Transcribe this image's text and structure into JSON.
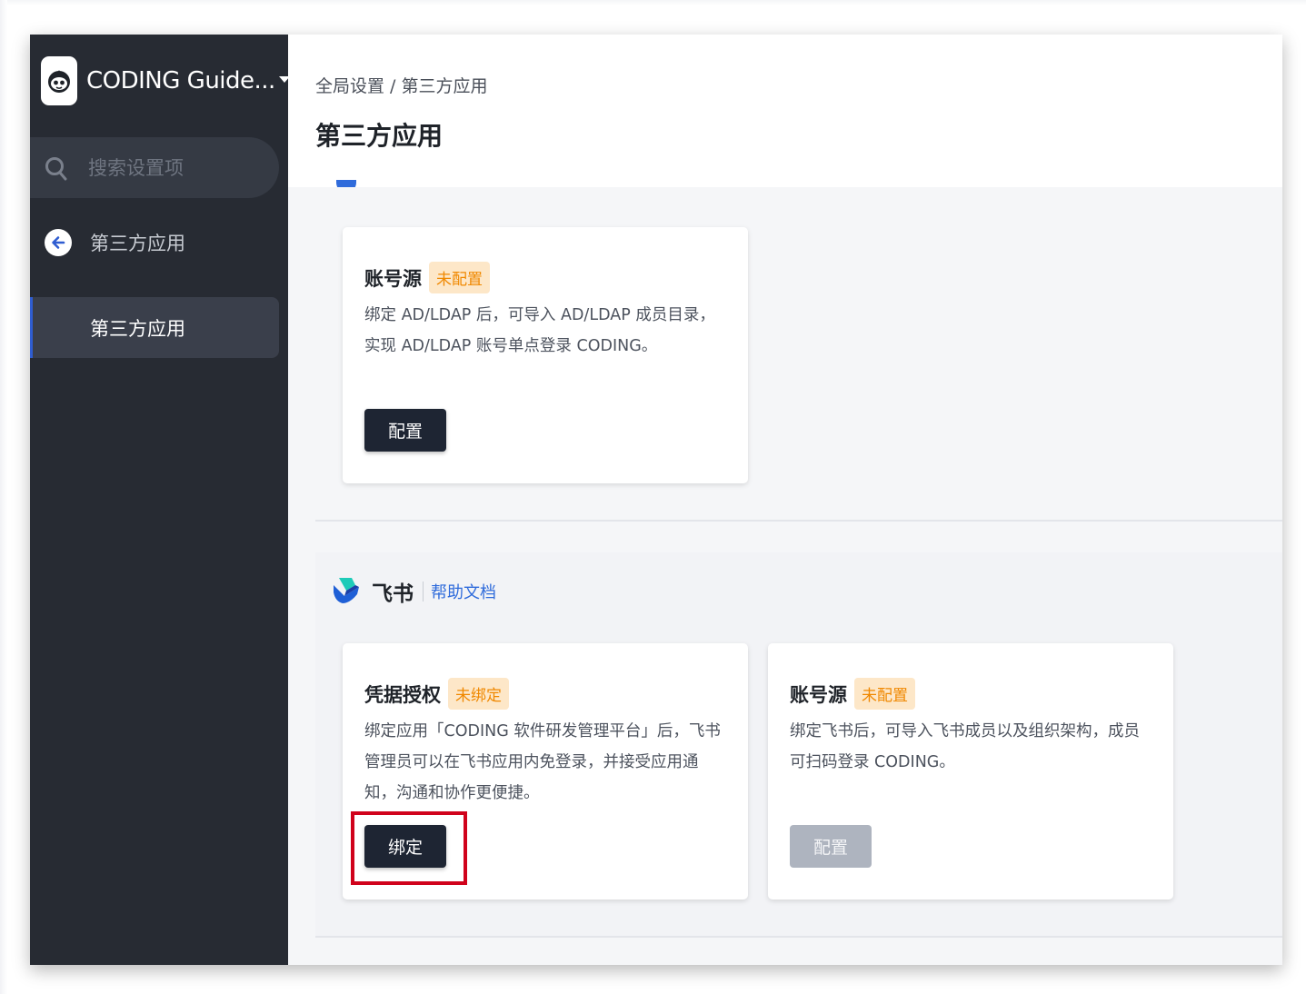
{
  "team": {
    "name": "CODING Guide...",
    "logo_icon": "octopus-logo-icon"
  },
  "search": {
    "placeholder": "搜索设置项"
  },
  "sidebar": {
    "back_label": "第三方应用",
    "active_item": "第三方应用"
  },
  "header": {
    "breadcrumb": "全局设置 / 第三方应用",
    "title": "第三方应用"
  },
  "ldap_section": {
    "cards": [
      {
        "name": "账号源",
        "status": "未配置",
        "description": "绑定 AD/LDAP 后，可导入 AD/LDAP 成员目录，实现 AD/LDAP 账号单点登录 CODING。",
        "button": "配置"
      }
    ]
  },
  "lark_section": {
    "name": "飞书",
    "help_link": "帮助文档",
    "cards": [
      {
        "name": "凭据授权",
        "status": "未绑定",
        "description": "绑定应用「CODING 软件研发管理平台」后，飞书管理员可以在飞书应用内免登录，并接受应用通知，沟通和协作更便捷。",
        "button": "绑定"
      },
      {
        "name": "账号源",
        "status": "未配置",
        "description": "绑定飞书后，可导入飞书成员以及组织架构，成员可扫码登录 CODING。",
        "button": "配置"
      }
    ]
  },
  "colors": {
    "sidebar_bg": "#272b33",
    "primary_button": "#1e2533",
    "status_badge_text": "#f08800",
    "status_badge_bg": "#fde7c8",
    "link": "#2f6bdb",
    "highlight": "#d0021b"
  }
}
